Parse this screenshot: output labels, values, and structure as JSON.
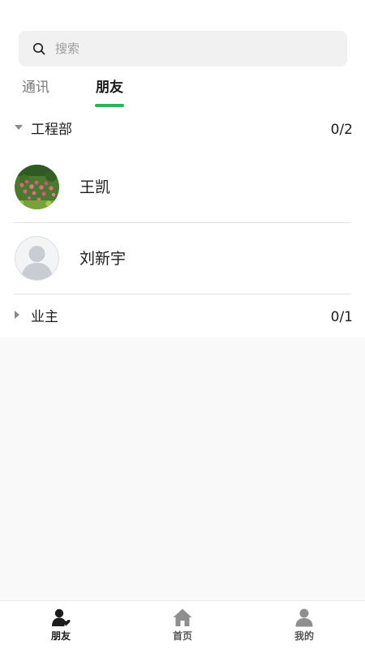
{
  "search": {
    "placeholder": "搜索"
  },
  "tabs": [
    {
      "label": "通讯",
      "active": false
    },
    {
      "label": "朋友",
      "active": true
    }
  ],
  "groups": [
    {
      "name": "工程部",
      "count": "0/2",
      "expanded": true,
      "friends": [
        {
          "name": "王凯",
          "avatar": "flower-photo-avatar"
        },
        {
          "name": "刘新宇",
          "avatar": "default-person-avatar"
        }
      ]
    },
    {
      "name": "业主",
      "count": "0/1",
      "expanded": false,
      "friends": []
    }
  ],
  "bottom_nav": [
    {
      "label": "朋友",
      "icon": "friends-icon",
      "active": true
    },
    {
      "label": "首页",
      "icon": "home-icon",
      "active": false
    },
    {
      "label": "我的",
      "icon": "profile-icon",
      "active": false
    }
  ],
  "colors": {
    "accent": "#2db45a",
    "active_nav": "#1c1c1c",
    "inactive_nav": "#555555",
    "background": "#f9f9f9"
  }
}
